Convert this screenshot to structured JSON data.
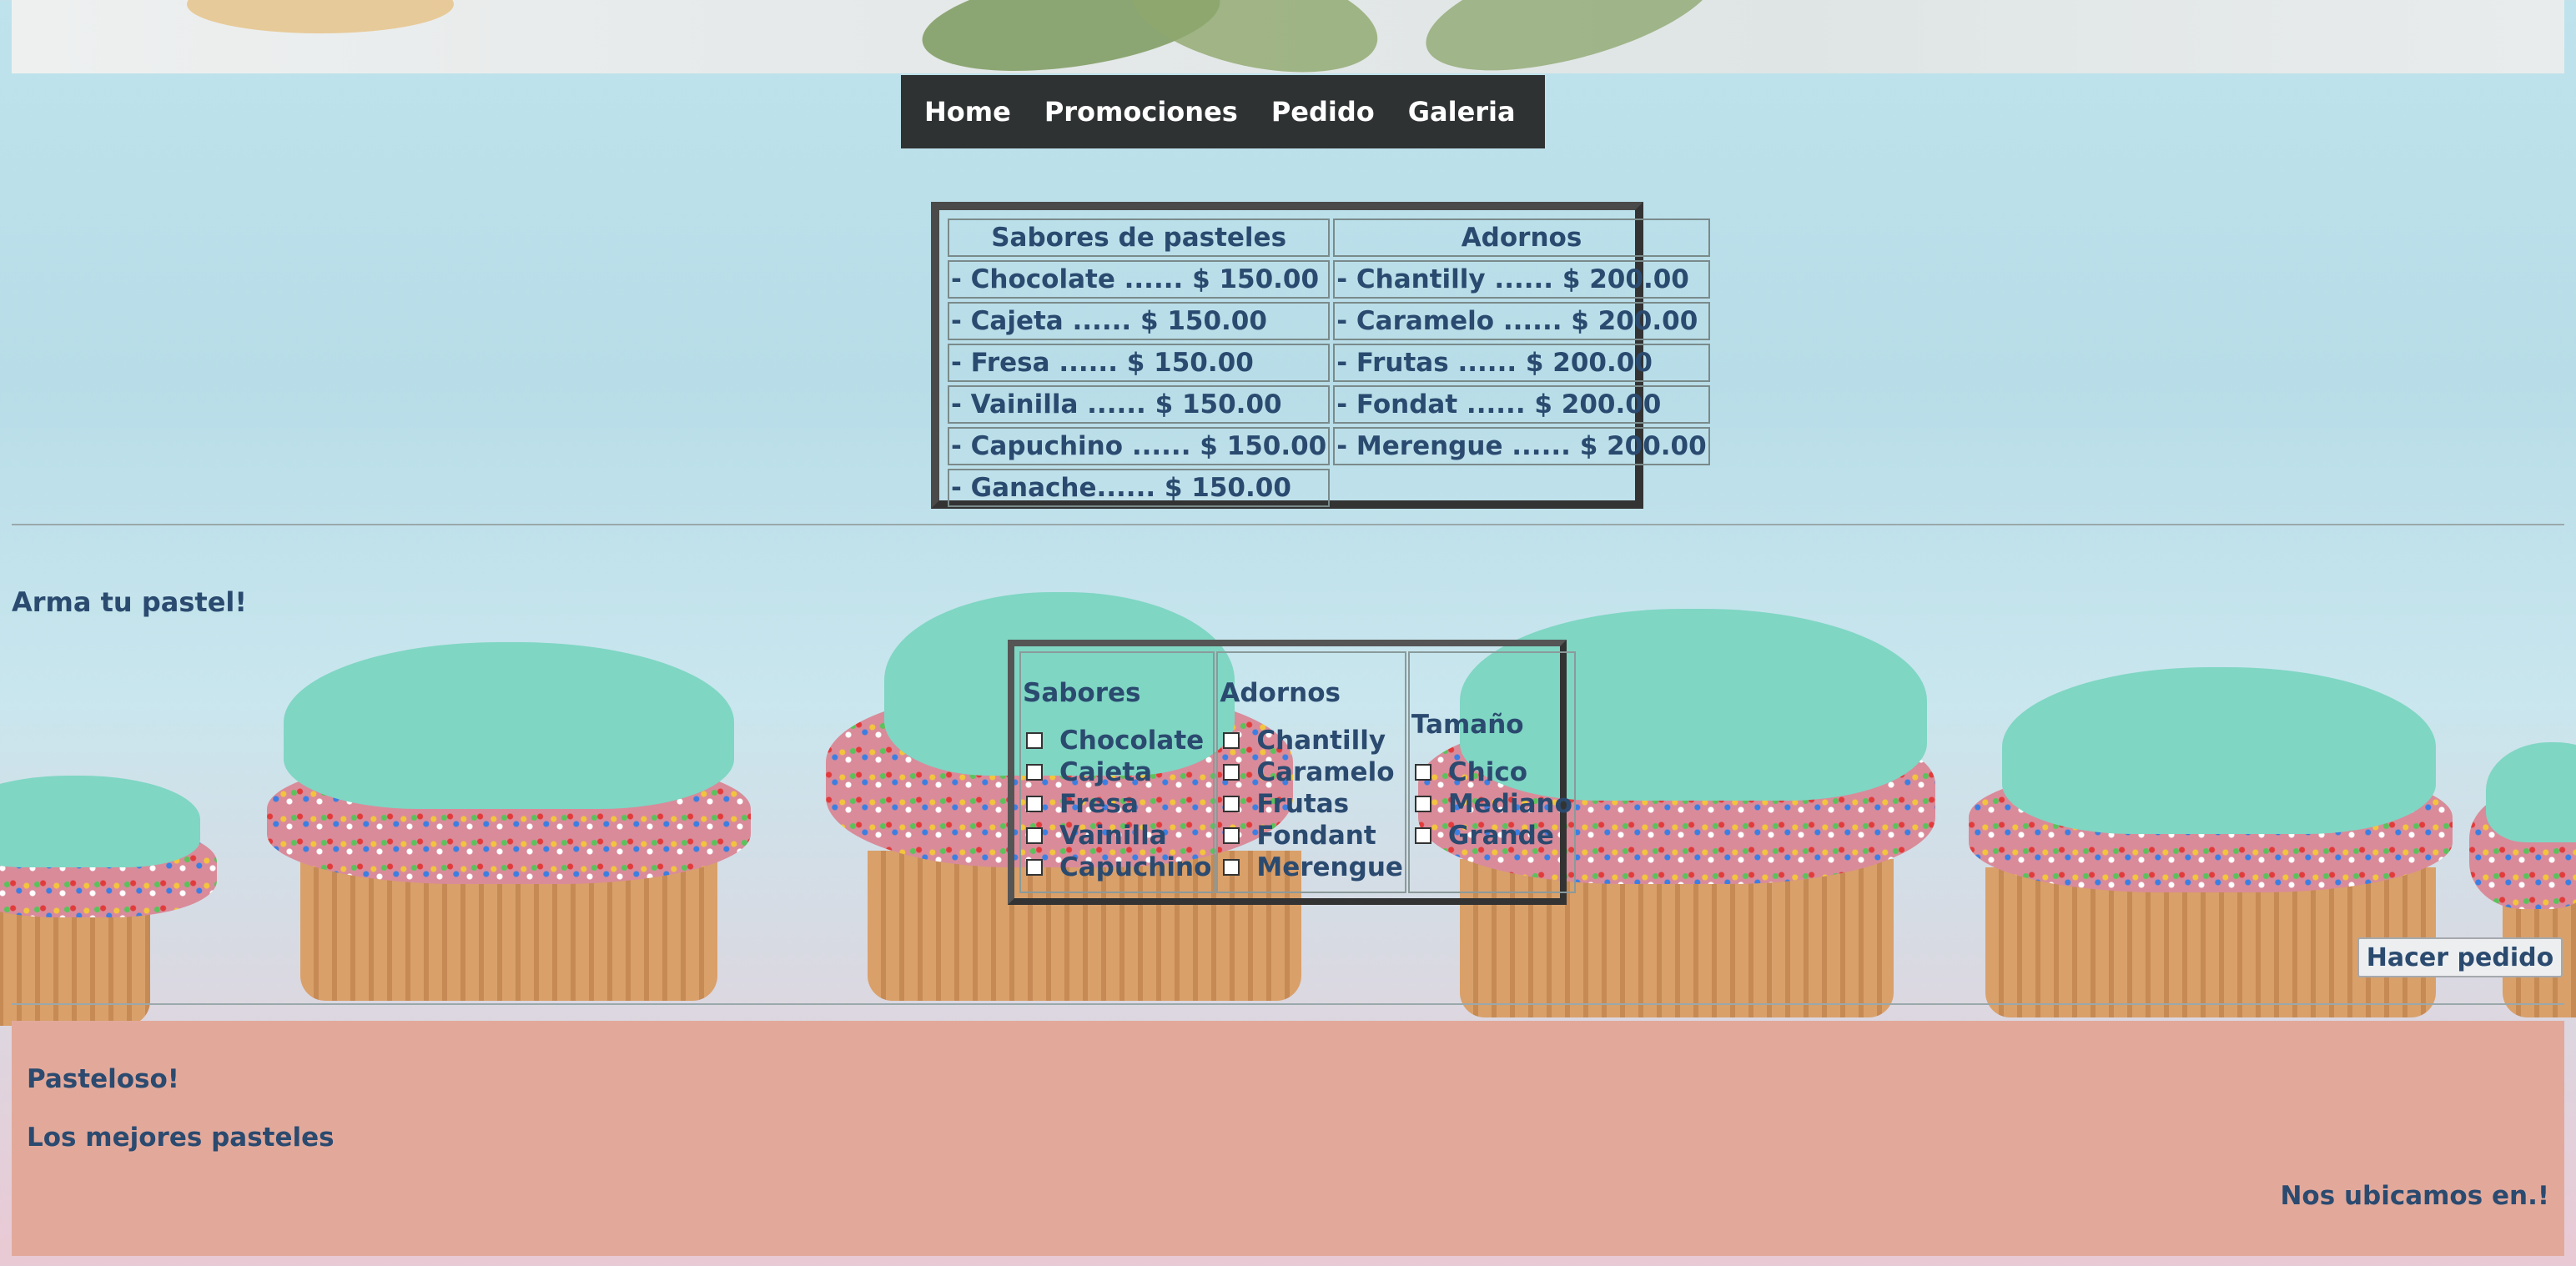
{
  "nav": {
    "items": [
      "Home",
      "Promociones",
      "Pedido",
      "Galeria"
    ]
  },
  "prices": {
    "headers": [
      "Sabores de pasteles",
      "Adornos"
    ],
    "rows": [
      [
        "- Chocolate ...... $ 150.00",
        "- Chantilly ...... $ 200.00"
      ],
      [
        "- Cajeta ...... $ 150.00",
        "- Caramelo ...... $ 200.00"
      ],
      [
        "- Fresa ...... $ 150.00",
        "- Frutas ...... $ 200.00"
      ],
      [
        "- Vainilla ...... $ 150.00",
        "- Fondat ...... $ 200.00"
      ],
      [
        "- Capuchino ...... $ 150.00",
        "- Merengue ...... $ 200.00"
      ],
      [
        "- Ganache...... $ 150.00",
        ""
      ]
    ]
  },
  "builder": {
    "title": "Arma tu pastel!",
    "sabores": {
      "label": "Sabores",
      "options": [
        "Chocolate",
        "Cajeta",
        "Fresa",
        "Vainilla",
        "Capuchino"
      ]
    },
    "adornos": {
      "label": "Adornos",
      "options": [
        "Chantilly",
        "Caramelo",
        "Frutas",
        "Fondant",
        "Merengue"
      ]
    },
    "tamano": {
      "label": "Tamaño",
      "options": [
        "Chico",
        "Mediano",
        "Grande"
      ]
    },
    "submit_label": "Hacer pedido"
  },
  "footer": {
    "brand": "Pasteloso!",
    "tagline": "Los mejores pasteles",
    "location": "Nos ubicamos en.!"
  },
  "colors": {
    "nav_bg": "#2f3233",
    "text": "#2b4a6f",
    "footer_bg": "#e2a99b",
    "frosting": "#7fd6c3"
  }
}
